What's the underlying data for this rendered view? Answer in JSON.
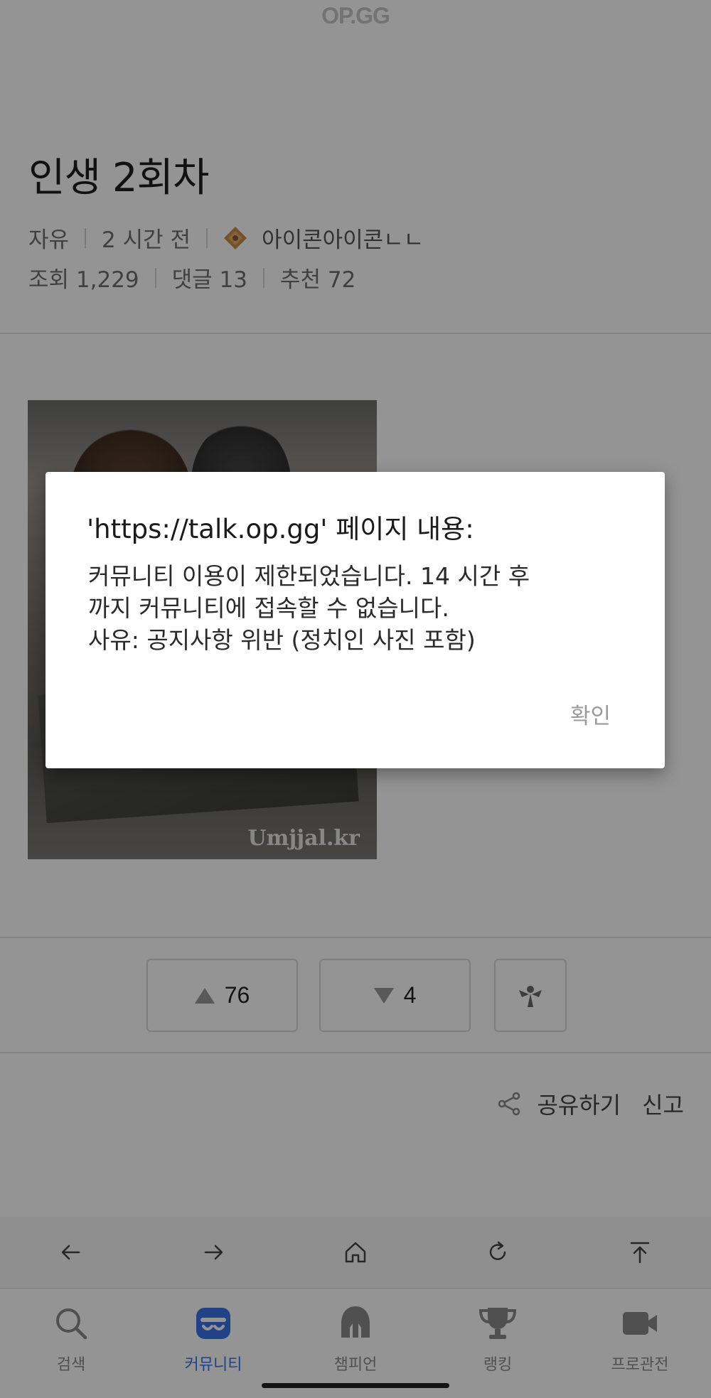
{
  "header": {
    "logo": "OP.GG"
  },
  "post": {
    "title": "인생 2회차",
    "category": "자유",
    "time_ago": "2 시간 전",
    "author": "아이콘아이콘ㄴㄴ",
    "views": "조회 1,229",
    "comments": "댓글 13",
    "recommend": "추천 72",
    "image_watermark": "Umjjal.kr"
  },
  "votes": {
    "up_count": "76",
    "down_count": "4"
  },
  "actions": {
    "share_label": "공유하기",
    "report_label": "신고"
  },
  "browser_nav": {
    "icons": [
      "back-arrow-icon",
      "forward-arrow-icon",
      "home-icon",
      "refresh-icon",
      "scroll-top-icon"
    ]
  },
  "tab_bar": {
    "tabs": [
      {
        "label": "검색",
        "icon": "search-icon"
      },
      {
        "label": "커뮤니티",
        "icon": "community-icon",
        "active": true
      },
      {
        "label": "챔피언",
        "icon": "champion-helmet-icon"
      },
      {
        "label": "랭킹",
        "icon": "trophy-icon"
      },
      {
        "label": "프로관전",
        "icon": "video-camera-icon"
      }
    ]
  },
  "dialog": {
    "title": "'https://talk.op.gg' 페이지 내용:",
    "message_lines": [
      "커뮤니티 이용이 제한되었습니다. 14 시간 후",
      "까지 커뮤니티에 접속할 수 없습니다.",
      "사유: 공지사항 위반 (정치인 사진 포함)"
    ],
    "ok_label": "확인"
  },
  "colors": {
    "accent": "#3a73e8",
    "overlay": "rgba(0,0,0,0.42)",
    "tier_icon": "#c88a4a"
  }
}
